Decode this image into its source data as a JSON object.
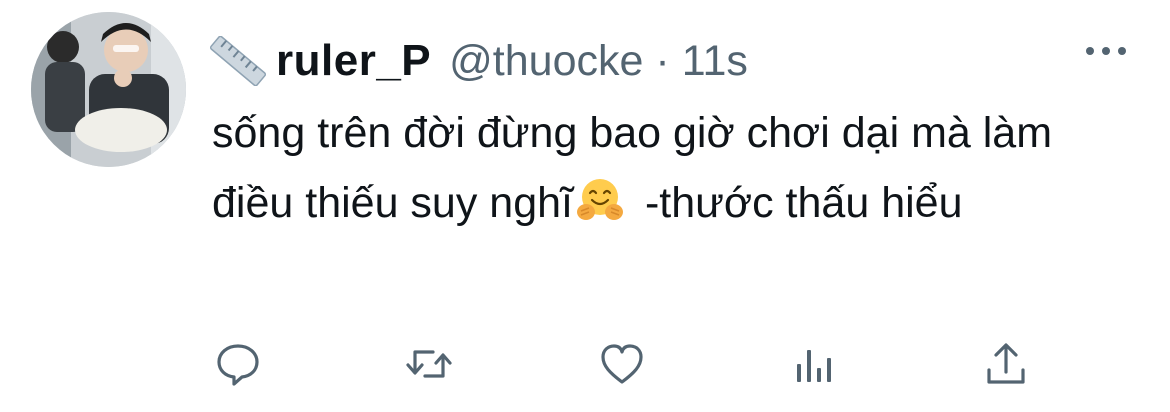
{
  "tweet": {
    "author": {
      "display_name": "ruler_P",
      "handle": "@thuocke",
      "name_icon": "ruler-emoji-icon"
    },
    "separator": "·",
    "timestamp": "11s",
    "text_before_emoji": "sống trên đời đừng bao giờ chơi dại mà làm điều thiếu suy nghĩ",
    "emoji": "hugging-face-emoji-icon",
    "text_after_emoji": " -thước thấu hiểu",
    "more_menu_icon": "more-dots-icon"
  },
  "actions": [
    {
      "name": "reply",
      "icon": "reply-icon"
    },
    {
      "name": "retweet",
      "icon": "retweet-icon"
    },
    {
      "name": "like",
      "icon": "heart-icon"
    },
    {
      "name": "analytics",
      "icon": "analytics-icon"
    },
    {
      "name": "share",
      "icon": "share-icon"
    }
  ],
  "colors": {
    "text_primary": "#0f1419",
    "text_secondary": "#536471",
    "background": "#ffffff"
  }
}
